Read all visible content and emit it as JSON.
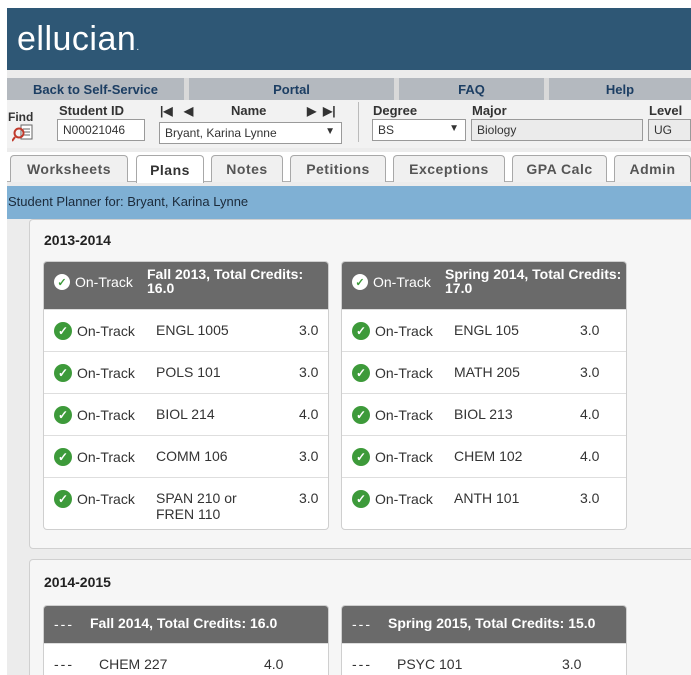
{
  "header": {
    "logo": "ellucian",
    "logo_mark": "."
  },
  "nav": [
    "Back to Self-Service",
    "Portal",
    "FAQ",
    "Help"
  ],
  "student": {
    "find_label": "Find",
    "id_label": "Student ID",
    "id_value": "N00021046",
    "name_label": "Name",
    "name_value": "Bryant, Karina Lynne",
    "degree_label": "Degree",
    "degree_value": "BS",
    "major_label": "Major",
    "major_value": "Biology",
    "level_label": "Level",
    "level_value": "UG"
  },
  "tabs": [
    "Worksheets",
    "Plans",
    "Notes",
    "Petitions",
    "Exceptions",
    "GPA Calc",
    "Admin"
  ],
  "active_tab": "Plans",
  "planner_title": "Student Planner for: Bryant, Karina Lynne",
  "years": [
    {
      "title": "2013-2014",
      "terms": [
        {
          "status": "On-Track",
          "title": "Fall 2013, Total Credits: 16.0",
          "courses": [
            {
              "status": "On-Track",
              "course": "ENGL 1005",
              "credits": "3.0"
            },
            {
              "status": "On-Track",
              "course": "POLS 101",
              "credits": "3.0"
            },
            {
              "status": "On-Track",
              "course": "BIOL 214",
              "credits": "4.0"
            },
            {
              "status": "On-Track",
              "course": "COMM 106",
              "credits": "3.0"
            },
            {
              "status": "On-Track",
              "course": "SPAN 210 or FREN 110",
              "credits": "3.0"
            }
          ]
        },
        {
          "status": "On-Track",
          "title": "Spring 2014, Total Credits: 17.0",
          "courses": [
            {
              "status": "On-Track",
              "course": "ENGL 105",
              "credits": "3.0"
            },
            {
              "status": "On-Track",
              "course": "MATH 205",
              "credits": "3.0"
            },
            {
              "status": "On-Track",
              "course": "BIOL 213",
              "credits": "4.0"
            },
            {
              "status": "On-Track",
              "course": "CHEM 102",
              "credits": "4.0"
            },
            {
              "status": "On-Track",
              "course": "ANTH 101",
              "credits": "3.0"
            }
          ]
        }
      ]
    },
    {
      "title": "2014-2015",
      "terms": [
        {
          "status": "---",
          "title": "Fall 2014, Total Credits: 16.0",
          "courses": [
            {
              "status": "---",
              "course": "CHEM 227",
              "credits": "4.0"
            }
          ]
        },
        {
          "status": "---",
          "title": "Spring 2015, Total Credits: 15.0",
          "courses": [
            {
              "status": "---",
              "course": "PSYC 101",
              "credits": "3.0"
            }
          ]
        }
      ]
    }
  ],
  "colors": {
    "header": "#2e5775",
    "planner_bar": "#7fb0d4",
    "on_track": "#3d9a3a",
    "term_head": "#6a6a6a"
  }
}
